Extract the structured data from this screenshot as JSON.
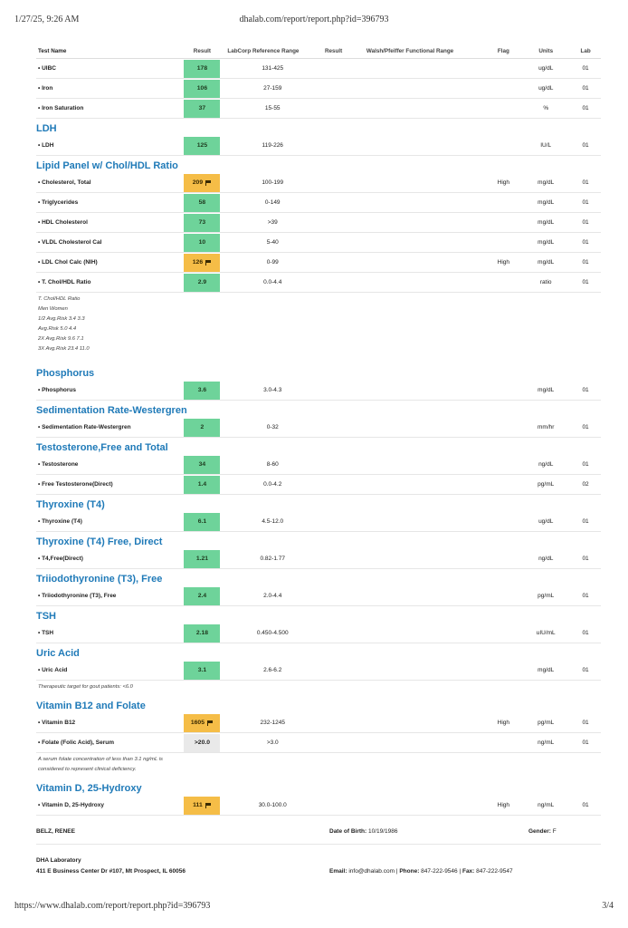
{
  "print_header": {
    "datetime": "1/27/25, 9:26 AM",
    "url": "dhalab.com/report/report.php?id=396793"
  },
  "print_footer": {
    "url": "https://www.dhalab.com/report/report.php?id=396793",
    "page": "3/4"
  },
  "columns": {
    "test_name": "Test Name",
    "result": "Result",
    "labcorp_range": "LabCorp Reference Range",
    "result2": "Result",
    "walsh_range": "Walsh/Pfeiffer Functional Range",
    "flag": "Flag",
    "units": "Units",
    "lab": "Lab"
  },
  "blocks": [
    {
      "tests": [
        {
          "name": "• UIBC",
          "result": "178",
          "status": "normal",
          "ref": "131-425",
          "flag": "",
          "units": "ug/dL",
          "lab": "01"
        },
        {
          "name": "• Iron",
          "result": "106",
          "status": "normal",
          "ref": "27-159",
          "flag": "",
          "units": "ug/dL",
          "lab": "01"
        },
        {
          "name": "• Iron Saturation",
          "result": "37",
          "status": "normal",
          "ref": "15-55",
          "flag": "",
          "units": "%",
          "lab": "01"
        }
      ]
    },
    {
      "title": "LDH",
      "tests": [
        {
          "name": "• LDH",
          "result": "125",
          "status": "normal",
          "ref": "119-226",
          "flag": "",
          "units": "IU/L",
          "lab": "01"
        }
      ]
    },
    {
      "title": "Lipid Panel w/ Chol/HDL Ratio",
      "tests": [
        {
          "name": "• Cholesterol, Total",
          "result": "209",
          "status": "high",
          "ref": "100-199",
          "flag": "High",
          "units": "mg/dL",
          "lab": "01"
        },
        {
          "name": "• Triglycerides",
          "result": "58",
          "status": "normal",
          "ref": "0-149",
          "flag": "",
          "units": "mg/dL",
          "lab": "01"
        },
        {
          "name": "• HDL Cholesterol",
          "result": "73",
          "status": "normal",
          "ref": ">39",
          "flag": "",
          "units": "mg/dL",
          "lab": "01"
        },
        {
          "name": "• VLDL Cholesterol Cal",
          "result": "10",
          "status": "normal",
          "ref": "5-40",
          "flag": "",
          "units": "mg/dL",
          "lab": "01"
        },
        {
          "name": "• LDL Chol Calc (NIH)",
          "result": "126",
          "status": "high",
          "ref": "0-99",
          "flag": "High",
          "units": "mg/dL",
          "lab": "01"
        },
        {
          "name": "• T. Chol/HDL Ratio",
          "result": "2.9",
          "status": "normal",
          "ref": "0.0-4.4",
          "flag": "",
          "units": "ratio",
          "lab": "01",
          "note": [
            "T. Chol/HDL Ratio",
            "Men Women",
            "1/2 Avg.Risk 3.4 3.3",
            "Avg.Risk 5.0 4.4",
            "2X Avg.Risk 9.6 7.1",
            "3X Avg.Risk 23.4 11.0"
          ]
        }
      ]
    },
    {
      "title": "Phosphorus",
      "tests": [
        {
          "name": "• Phosphorus",
          "result": "3.6",
          "status": "normal",
          "ref": "3.0-4.3",
          "flag": "",
          "units": "mg/dL",
          "lab": "01"
        }
      ]
    },
    {
      "title": "Sedimentation Rate-Westergren",
      "tests": [
        {
          "name": "• Sedimentation Rate-Westergren",
          "result": "2",
          "status": "normal",
          "ref": "0-32",
          "flag": "",
          "units": "mm/hr",
          "lab": "01"
        }
      ]
    },
    {
      "title": "Testosterone,Free and Total",
      "tests": [
        {
          "name": "• Testosterone",
          "result": "34",
          "status": "normal",
          "ref": "8-60",
          "flag": "",
          "units": "ng/dL",
          "lab": "01"
        },
        {
          "name": "• Free Testosterone(Direct)",
          "result": "1.4",
          "status": "normal",
          "ref": "0.0-4.2",
          "flag": "",
          "units": "pg/mL",
          "lab": "02"
        }
      ]
    },
    {
      "title": "Thyroxine (T4)",
      "tests": [
        {
          "name": "• Thyroxine (T4)",
          "result": "6.1",
          "status": "normal",
          "ref": "4.5-12.0",
          "flag": "",
          "units": "ug/dL",
          "lab": "01"
        }
      ]
    },
    {
      "title": "Thyroxine (T4) Free, Direct",
      "tests": [
        {
          "name": "• T4,Free(Direct)",
          "result": "1.21",
          "status": "normal",
          "ref": "0.82-1.77",
          "flag": "",
          "units": "ng/dL",
          "lab": "01"
        }
      ]
    },
    {
      "title": "Triiodothyronine (T3), Free",
      "tests": [
        {
          "name": "• Triiodothyronine (T3), Free",
          "result": "2.4",
          "status": "normal",
          "ref": "2.0-4.4",
          "flag": "",
          "units": "pg/mL",
          "lab": "01"
        }
      ]
    },
    {
      "title": "TSH",
      "tests": [
        {
          "name": "• TSH",
          "result": "2.18",
          "status": "normal",
          "ref": "0.450-4.500",
          "flag": "",
          "units": "uIU/mL",
          "lab": "01"
        }
      ]
    },
    {
      "title": "Uric Acid",
      "tests": [
        {
          "name": "• Uric Acid",
          "result": "3.1",
          "status": "normal",
          "ref": "2.6-6.2",
          "flag": "",
          "units": "mg/dL",
          "lab": "01",
          "note": [
            "Therapeutic target for gout patients: <6.0"
          ]
        }
      ]
    },
    {
      "title": "Vitamin B12 and Folate",
      "tests": [
        {
          "name": "• Vitamin B12",
          "result": "1605",
          "status": "high",
          "ref": "232-1245",
          "flag": "High",
          "units": "pg/mL",
          "lab": "01"
        },
        {
          "name": "• Folate (Folic Acid), Serum",
          "result": ">20.0",
          "status": "neutral",
          "ref": ">3.0",
          "flag": "",
          "units": "ng/mL",
          "lab": "01",
          "note": [
            "A serum folate concentration of less than 3.1 ng/mL is",
            "considered to represent clinical deficiency."
          ]
        }
      ]
    },
    {
      "title": "Vitamin D, 25-Hydroxy",
      "tests": [
        {
          "name": "• Vitamin D, 25-Hydroxy",
          "result": "111",
          "status": "high",
          "ref": "30.0-100.0",
          "flag": "High",
          "units": "ng/mL",
          "lab": "01"
        }
      ]
    }
  ],
  "patient": {
    "name": "BELZ, RENEE",
    "dob_label": "Date of Birth:",
    "dob": "10/19/1986",
    "gender_label": "Gender:",
    "gender": "F"
  },
  "lab_info": {
    "name": "DHA Laboratory",
    "address": "411 E Business Center Dr #107, Mt Prospect, IL 60056",
    "email_label": "Email:",
    "email": "info@dhalab.com",
    "phone_label": "Phone:",
    "phone": "847-222-9546",
    "fax_label": "Fax:",
    "fax": "847-222-9547"
  }
}
